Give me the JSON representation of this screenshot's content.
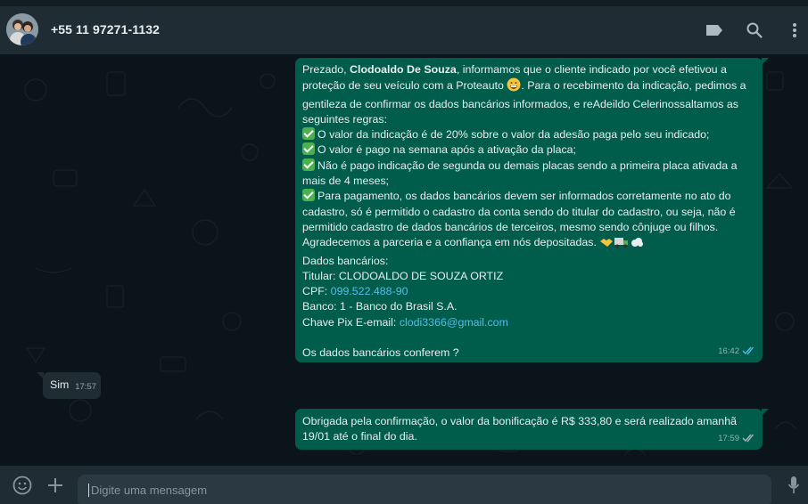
{
  "contact": {
    "name": "+55 11 97271-1132"
  },
  "messages": [
    {
      "direction": "outgoing",
      "lines": [
        [
          "Prezado, ",
          "Clodoaldo De Souza",
          ", informamos que o cliente indicado por você efetivou a"
        ],
        "proteção de seu veículo com a Proteauto",
        ". Para o recebimento da indicação, pedimos a",
        "gentileza de confirmar os dados bancários informados, e reAdeildo Celerinossaltamos as",
        "seguintes regras:",
        "O valor da indicação é de 20% sobre o valor da adesão paga pelo seu indicado;",
        "O valor é pago na semana após a ativação da placa;",
        "Não é pago indicação de segunda ou demais placas sendo a primeira placa ativada a",
        "mais de 4 meses;",
        "Para pagamento, os dados bancários devem ser informados corretamente no ato do",
        "cadastro, só é permitido o cadastro da conta sendo do titular do cadastro, ou seja, não é",
        "permitido cadastro de dados bancários de terceiros, mesmo sendo cônjuge ou filhos.",
        "Agradecemos a parceria e a confiança em nós depositadas.",
        "Dados bancários:",
        "Titular: CLODOALDO DE SOUZA ORTIZ",
        "CPF: ",
        "099.522.488-90",
        "Banco: 1 - Banco do Brasil S.A.",
        "Chave Pix E-email:  ",
        "clodi3366@gmail.com",
        "Os dados bancários conferem ?"
      ],
      "time": "16:42",
      "status": "read"
    },
    {
      "direction": "incoming",
      "text": "Sim",
      "time": "17:57"
    },
    {
      "direction": "outgoing",
      "lines": [
        "Obrigada pela confirmação, o valor da bonificação é R$ 333,80 e será realizado amanhã",
        "19/01 até o final do dia."
      ],
      "time": "17:59",
      "status": "read"
    }
  ],
  "composer": {
    "placeholder": "Digite uma mensagem"
  },
  "icons": {
    "header": [
      "label-icon",
      "search-icon",
      "menu-icon"
    ],
    "footer": [
      "emoji-icon",
      "attach-plus-icon",
      "microphone-icon"
    ]
  },
  "colors": {
    "outgoing_bubble": "#005c4b",
    "incoming_bubble": "#202c33",
    "read_ticks": "#53bdeb",
    "header_bg": "#202c33",
    "chat_bg": "#0b141a"
  }
}
